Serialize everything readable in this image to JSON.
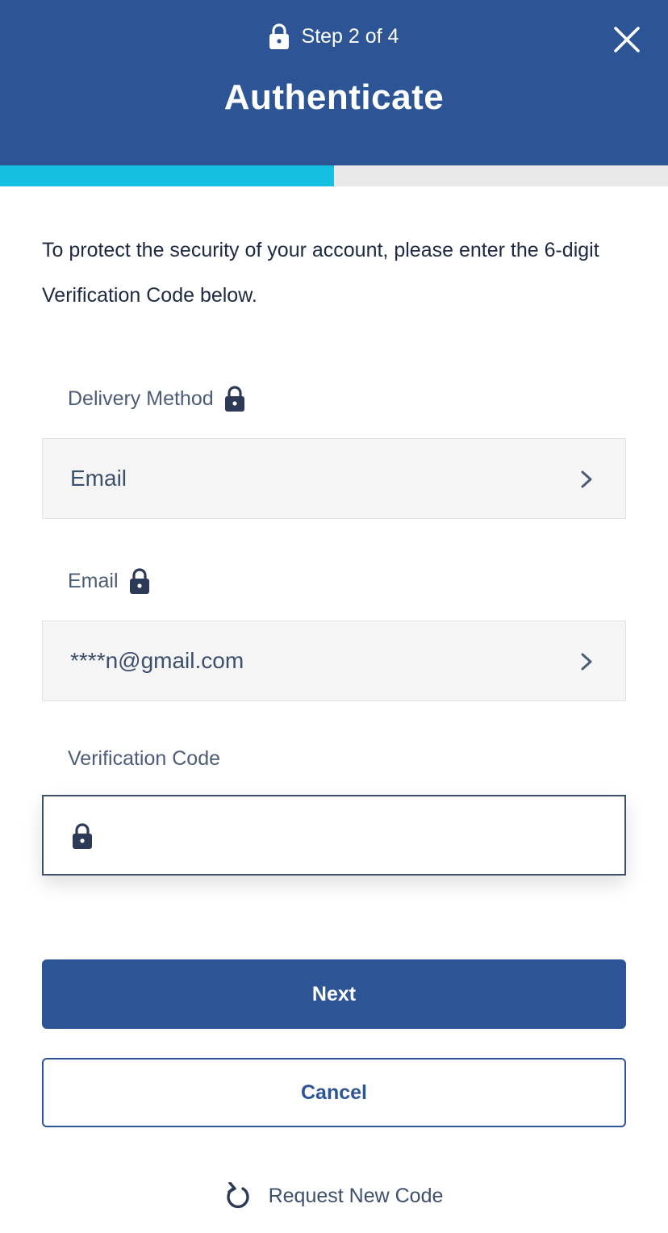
{
  "header": {
    "step_text": "Step 2 of 4",
    "title": "Authenticate",
    "step_icon": "lock-icon",
    "close_icon": "close-icon",
    "background_color": "#2d5596"
  },
  "progress": {
    "fraction": 0.5,
    "fill_color": "#14bfe0",
    "track_color": "#e9e9e9"
  },
  "intro": {
    "text": "To protect the security of your account, please enter the 6-digit Verification Code below."
  },
  "delivery_method": {
    "label": "Delivery Method",
    "value": "Email",
    "icon": "chevron-right-icon"
  },
  "email": {
    "label": "Email",
    "value": "****n@gmail.com",
    "icon": "chevron-right-icon"
  },
  "verification_code": {
    "label": "Verification Code",
    "value": "",
    "placeholder": ""
  },
  "actions": {
    "next_label": "Next",
    "cancel_label": "Cancel",
    "request_new_code_label": "Request New Code",
    "request_icon": "refresh-icon"
  }
}
